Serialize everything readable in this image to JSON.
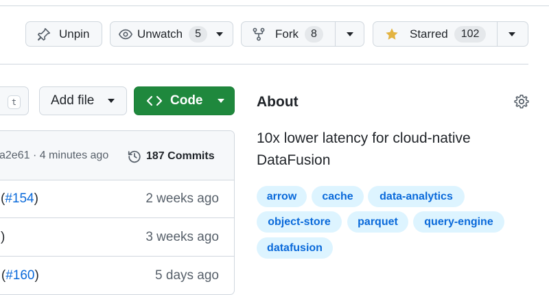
{
  "header_actions": {
    "unpin": {
      "label": "Unpin",
      "icon": "pin-icon"
    },
    "unwatch": {
      "label": "Unwatch",
      "count": "5",
      "icon": "eye-icon"
    },
    "fork": {
      "label": "Fork",
      "count": "8",
      "icon": "repo-forked-icon"
    },
    "star": {
      "label": "Starred",
      "count": "102",
      "icon": "star-fill-icon",
      "icon_color": "#e3b341"
    }
  },
  "toolbar": {
    "shortcut_key": "t",
    "add_file_label": "Add file",
    "code_label": "Code",
    "code_color": "#1f883d"
  },
  "latest_commit": {
    "meta": "a2e61 · 4 minutes ago",
    "commits_count": "187 Commits"
  },
  "files": [
    {
      "message_prefix": "(",
      "message_link": "#154",
      "message_suffix": ")",
      "when": "2 weeks ago"
    },
    {
      "message_prefix": ")",
      "message_link": "",
      "message_suffix": "",
      "when": "3 weeks ago"
    },
    {
      "message_prefix": "e (",
      "message_link": "#160",
      "message_suffix": ")",
      "when": "5 days ago"
    }
  ],
  "about": {
    "title": "About",
    "description": "10x lower latency for cloud-native DataFusion",
    "topics": [
      "arrow",
      "cache",
      "data-analytics",
      "object-store",
      "parquet",
      "query-engine",
      "datafusion"
    ]
  },
  "colors": {
    "link": "#0969da",
    "topic_bg": "#ddf4ff",
    "border": "#d0d7de"
  }
}
